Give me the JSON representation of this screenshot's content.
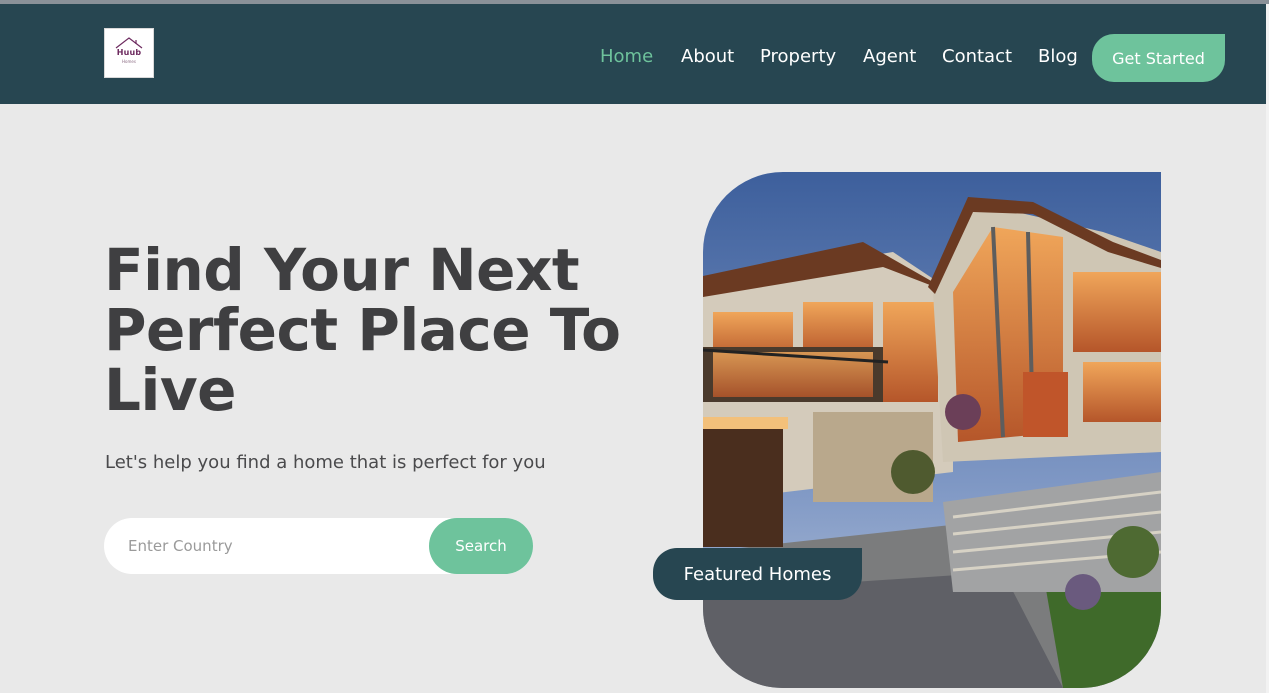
{
  "brand": {
    "logo_text": "Huub",
    "logo_sub": "Homes"
  },
  "nav": {
    "items": [
      {
        "label": "Home",
        "active": true
      },
      {
        "label": "About"
      },
      {
        "label": "Property"
      },
      {
        "label": "Agent"
      },
      {
        "label": "Contact"
      },
      {
        "label": "Blog"
      }
    ],
    "cta_label": "Get Started"
  },
  "hero": {
    "title": "Find Your Next Perfect Place To Live",
    "subtitle": "Let's help you find a home that is perfect for you",
    "search": {
      "placeholder": "Enter Country",
      "value": "",
      "button_label": "Search"
    },
    "featured_label": "Featured Homes"
  },
  "colors": {
    "navbar": "#274651",
    "accent": "#6ec39c",
    "page_bg": "#e9e9e9",
    "heading": "#3f3f41"
  }
}
